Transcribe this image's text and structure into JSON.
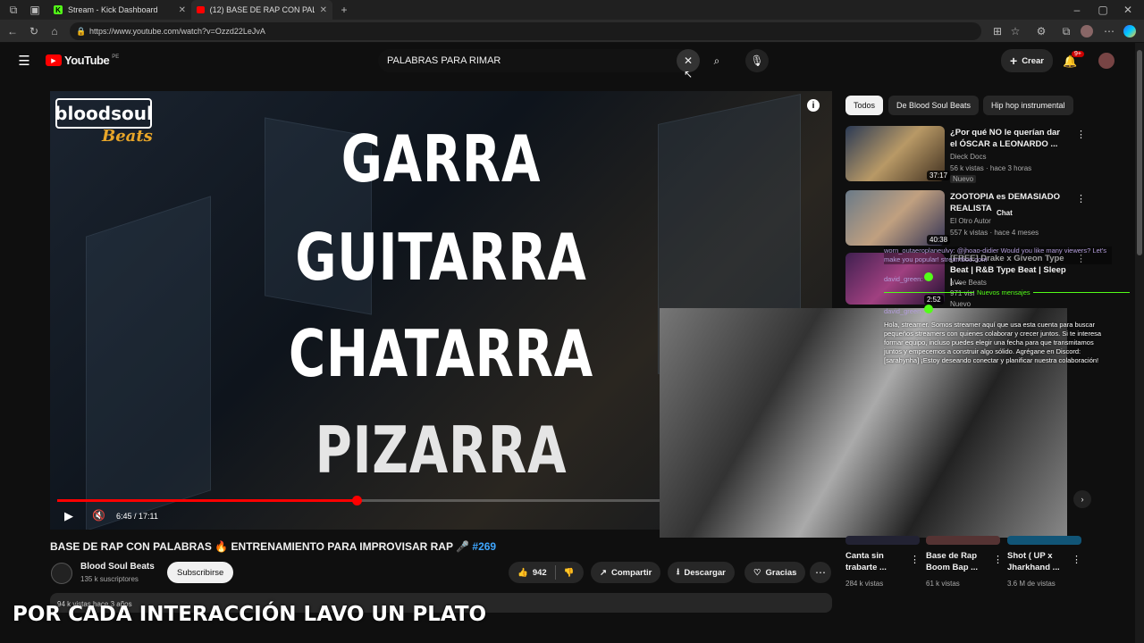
{
  "browser": {
    "tabs": [
      {
        "label": "Stream - Kick Dashboard",
        "icon": "kick-icon"
      },
      {
        "label": "(12) BASE DE RAP CON PALABRAS",
        "icon": "youtube-tab-icon"
      }
    ],
    "url": "https://www.youtube.com/watch?v=Ozzd22LeJvA"
  },
  "youtube": {
    "logo": "YouTube",
    "country": "PE",
    "search_value": "PALABRAS PARA RIMAR",
    "create_label": "Crear",
    "notif_count": "9+"
  },
  "video": {
    "words": [
      "GARRA",
      "GUITARRA",
      "CHATARRA",
      "PIZARRA"
    ],
    "brand_top": "bloodsoul",
    "brand_bottom": "Beats",
    "time": "6:45 / 17:11",
    "progress": 0.39,
    "title_text": "BASE DE RAP CON PALABRAS 🔥 ENTRENAMIENTO PARA IMPROVISAR RAP 🎤",
    "hashtag": "#269",
    "channel": "Blood Soul Beats",
    "subscribers": "135 k suscriptores",
    "subscribe_label": "Subscribirse",
    "likes": "942",
    "share_label": "Compartir",
    "download_label": "Descargar",
    "thanks_label": "Gracias",
    "views_meta": "94 k vistas  hace 3 años"
  },
  "sidebar": {
    "chips": [
      "Todos",
      "De Blood Soul Beats",
      "Hip hop instrumental"
    ],
    "videos": [
      {
        "title": "¿Por qué NO le querían dar el ÓSCAR a LEONARDO ...",
        "channel": "Dieck Docs",
        "meta": "56 k vistas · hace 3 horas",
        "badge": "Nuevo",
        "duration": "37:17"
      },
      {
        "title": "ZOOTOPIA es DEMASIADO REALISTA",
        "channel": "El Otro Autor",
        "meta": "557 k vistas · hace 4 meses",
        "badge": "",
        "duration": "40:38"
      },
      {
        "title": "[FREE] Drake x Giveon Type Beat | R&B Type Beat | Sleep | ...",
        "channel": "aVee Beats",
        "meta": "971 vistas",
        "badge": "Nuevo",
        "duration": "2:52"
      }
    ],
    "bottom_videos": [
      {
        "title": "Canta sin trabarte ...",
        "meta": "284 k vistas"
      },
      {
        "title": "Base de Rap Boom Bap ...",
        "meta": "61 k vistas"
      },
      {
        "title": "Shot ( UP x Jharkhand ...",
        "meta": "3.6 M de vistas"
      }
    ]
  },
  "chat": {
    "header": "Chat",
    "lines": [
      "worn_outaeroplaneulvy: @jhoao-didier Would you like many viewers? Let's make you popular! streamboo.com",
      "david_green:",
      "david_green:",
      "Nuevos mensajes",
      "Hola, streamer. Somos streamer aquí que usa esta cuenta para buscar pequeños streamers con quienes colaborar y crecer juntos. Si te interesa formar equipo, incluso puedes elegir una fecha para que transmitamos juntos y empecemos a construir algo sólido. Agrégane en Discord: [sarahynha] ¡Estoy deseando conectar y planificar nuestra colaboración!"
    ]
  },
  "overlay_text": "POR CADA INTERACCIÓN LAVO UN PLATO",
  "colors": {
    "youtube_red": "#ff0000",
    "accent_blue": "#3ea6ff",
    "progress_red": "#f00"
  }
}
